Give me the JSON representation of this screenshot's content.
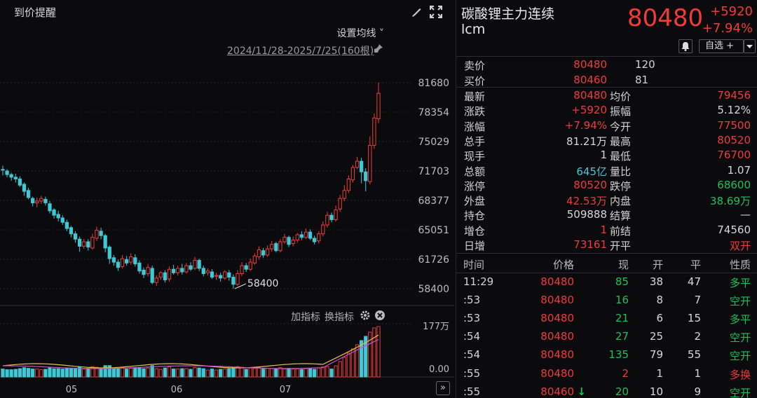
{
  "left": {
    "title": "到价提醒",
    "settings_label": "设置均线",
    "range_label": "2024/11/28-2025/7/25(160根)",
    "indicator_add": "加指标",
    "indicator_switch": "换指标",
    "nav_label": "»"
  },
  "chart_data": {
    "type": "candlestick",
    "y_ticks": [
      "81680",
      "78354",
      "75029",
      "71703",
      "68377",
      "65051",
      "61726",
      "58400"
    ],
    "x_ticks": [
      "05",
      "06",
      "07"
    ],
    "volume_ticks": [
      "177万",
      "0.00"
    ],
    "low_annotation": "58400",
    "ylim": [
      58400,
      81680
    ],
    "candles": [
      [
        71880,
        71800,
        72300,
        71200
      ],
      [
        71700,
        71300,
        71900,
        71000
      ],
      [
        71300,
        71000,
        71500,
        70600
      ],
      [
        71000,
        70800,
        71400,
        70400
      ],
      [
        70800,
        70100,
        71100,
        69900
      ],
      [
        70200,
        69400,
        70400,
        68900
      ],
      [
        69500,
        68700,
        69800,
        68500
      ],
      [
        68600,
        68100,
        68800,
        67700
      ],
      [
        68100,
        68300,
        68700,
        67600
      ],
      [
        68300,
        68600,
        68900,
        68000
      ],
      [
        68500,
        68100,
        68800,
        67800
      ],
      [
        68000,
        67200,
        68300,
        66900
      ],
      [
        67300,
        66700,
        67500,
        66300
      ],
      [
        66800,
        66400,
        67200,
        66000
      ],
      [
        66400,
        65900,
        66700,
        65600
      ],
      [
        65900,
        65200,
        66200,
        64900
      ],
      [
        65300,
        64600,
        65500,
        64200
      ],
      [
        64600,
        64000,
        64900,
        63600
      ],
      [
        64000,
        63200,
        64300,
        62600
      ],
      [
        63200,
        63700,
        64000,
        62900
      ],
      [
        63700,
        63100,
        64000,
        62700
      ],
      [
        63000,
        64200,
        64600,
        62800
      ],
      [
        64100,
        65000,
        65400,
        63800
      ],
      [
        64900,
        64400,
        65300,
        64000
      ],
      [
        64400,
        63000,
        64600,
        62500
      ],
      [
        63100,
        61800,
        63300,
        61200
      ],
      [
        61900,
        61400,
        62200,
        61000
      ],
      [
        61400,
        60800,
        61700,
        60400
      ],
      [
        60900,
        61800,
        62200,
        60700
      ],
      [
        61700,
        61300,
        62100,
        61000
      ],
      [
        61400,
        62000,
        62400,
        61100
      ],
      [
        61900,
        61200,
        62300,
        60900
      ],
      [
        61300,
        60400,
        61600,
        60100
      ],
      [
        60500,
        60000,
        60800,
        59600
      ],
      [
        60100,
        60800,
        61200,
        59800
      ],
      [
        60700,
        59100,
        61000,
        58900
      ],
      [
        59100,
        59600,
        59900,
        58700
      ],
      [
        59700,
        60200,
        60400,
        59400
      ],
      [
        60200,
        59400,
        60500,
        59100
      ],
      [
        59500,
        60600,
        60900,
        59200
      ],
      [
        60600,
        60200,
        61100,
        60000
      ],
      [
        60200,
        60700,
        61000,
        59900
      ],
      [
        60700,
        60300,
        61200,
        60000
      ],
      [
        60300,
        61000,
        61300,
        60100
      ],
      [
        61000,
        60600,
        61400,
        60400
      ],
      [
        60700,
        61600,
        62000,
        60500
      ],
      [
        61600,
        60700,
        61800,
        60400
      ],
      [
        60700,
        60100,
        61000,
        59800
      ],
      [
        60200,
        60400,
        60700,
        59900
      ],
      [
        60300,
        59700,
        60600,
        59500
      ],
      [
        59800,
        59900,
        60200,
        59400
      ],
      [
        59900,
        59600,
        60200,
        59200
      ],
      [
        59600,
        60300,
        60500,
        59400
      ],
      [
        60200,
        59700,
        60500,
        59300
      ],
      [
        59700,
        58900,
        60000,
        58400
      ],
      [
        58900,
        60100,
        60500,
        58700
      ],
      [
        60100,
        61000,
        61400,
        59800
      ],
      [
        61000,
        60600,
        61300,
        60300
      ],
      [
        60600,
        61400,
        61800,
        60400
      ],
      [
        61300,
        62100,
        62400,
        61100
      ],
      [
        62000,
        62800,
        63200,
        61700
      ],
      [
        62700,
        62200,
        63000,
        61900
      ],
      [
        62200,
        62900,
        63300,
        62000
      ],
      [
        62900,
        63400,
        63800,
        62600
      ],
      [
        63500,
        62700,
        63700,
        62500
      ],
      [
        62700,
        63700,
        64000,
        62500
      ],
      [
        63700,
        64200,
        64600,
        63500
      ],
      [
        64200,
        63400,
        64400,
        63100
      ],
      [
        63500,
        63900,
        64300,
        63200
      ],
      [
        63900,
        64500,
        64700,
        63600
      ],
      [
        64500,
        64200,
        64900,
        63900
      ],
      [
        64200,
        64800,
        65200,
        64000
      ],
      [
        64800,
        64100,
        65100,
        63900
      ],
      [
        64100,
        63700,
        64400,
        63400
      ],
      [
        63800,
        64600,
        64900,
        63500
      ],
      [
        64600,
        65600,
        66000,
        64300
      ],
      [
        65600,
        66700,
        67100,
        65300
      ],
      [
        66700,
        66200,
        67000,
        65900
      ],
      [
        66200,
        67300,
        67800,
        66000
      ],
      [
        67400,
        68600,
        69000,
        67100
      ],
      [
        68600,
        69500,
        70100,
        68300
      ],
      [
        69500,
        70800,
        71200,
        69200
      ],
      [
        70700,
        72100,
        72400,
        70400
      ],
      [
        72100,
        72800,
        73300,
        71900
      ],
      [
        72800,
        71600,
        73200,
        70300
      ],
      [
        71600,
        70600,
        72000,
        69400
      ],
      [
        70500,
        74600,
        75600,
        70200
      ],
      [
        74600,
        77700,
        78200,
        74200
      ],
      [
        77600,
        80480,
        81680,
        77100
      ]
    ]
  },
  "quote": {
    "name": "碳酸锂主力连续",
    "code": "lcm",
    "price": "80480",
    "change": "+5920",
    "change_pct": "+7.94%",
    "watch_label": "自选 +",
    "sell_label": "卖价",
    "sell_price": "80480",
    "sell_qty": "120",
    "buy_label": "买价",
    "buy_price": "80460",
    "buy_qty": "81",
    "stats": [
      {
        "l1": "最新",
        "v1": "80480",
        "c1": "red",
        "l2": "均价",
        "v2": "79456",
        "c2": "red"
      },
      {
        "l1": "涨跌",
        "v1": "+5920",
        "c1": "red",
        "l2": "振幅",
        "v2": "5.12%",
        "c2": "white"
      },
      {
        "l1": "涨幅",
        "v1": "+7.94%",
        "c1": "red",
        "l2": "今开",
        "v2": "77500",
        "c2": "red"
      },
      {
        "l1": "总手",
        "v1": "81.21万",
        "c1": "white",
        "l2": "最高",
        "v2": "80520",
        "c2": "red"
      },
      {
        "l1": "现手",
        "v1": "1",
        "c1": "white",
        "l2": "最低",
        "v2": "76700",
        "c2": "red"
      },
      {
        "l1": "总额",
        "v1": "645亿",
        "c1": "cyan",
        "l2": "量比",
        "v2": "1.07",
        "c2": "white"
      },
      {
        "l1": "涨停",
        "v1": "80520",
        "c1": "red",
        "l2": "跌停",
        "v2": "68600",
        "c2": "green"
      },
      {
        "l1": "外盘",
        "v1": "42.53万",
        "c1": "red",
        "l2": "内盘",
        "v2": "38.69万",
        "c2": "green"
      },
      {
        "l1": "持仓",
        "v1": "509888",
        "c1": "white",
        "l2": "结算",
        "v2": "—",
        "c2": "white"
      },
      {
        "l1": "增仓",
        "v1": "1",
        "c1": "red",
        "l2": "前结",
        "v2": "74560",
        "c2": "white"
      },
      {
        "l1": "日增",
        "v1": "73161",
        "c1": "red",
        "l2": "开平",
        "v2": "双开",
        "c2": "red"
      }
    ],
    "table_headers": [
      "时间",
      "价格",
      "现",
      "开",
      "平",
      "性质"
    ],
    "ticks": [
      {
        "time": "11:29",
        "price": "80480",
        "now": "85",
        "open": "38",
        "close": "47",
        "nature": "多平",
        "nc": "green",
        "nat": "green",
        "arrow": ""
      },
      {
        "time": ":53",
        "price": "80480",
        "now": "16",
        "open": "8",
        "close": "7",
        "nature": "空开",
        "nc": "green",
        "nat": "green",
        "arrow": ""
      },
      {
        "time": ":53",
        "price": "80480",
        "now": "21",
        "open": "6",
        "close": "15",
        "nature": "多平",
        "nc": "green",
        "nat": "green",
        "arrow": ""
      },
      {
        "time": ":54",
        "price": "80480",
        "now": "27",
        "open": "25",
        "close": "2",
        "nature": "空开",
        "nc": "green",
        "nat": "green",
        "arrow": ""
      },
      {
        "time": ":54",
        "price": "80480",
        "now": "135",
        "open": "79",
        "close": "55",
        "nature": "空开",
        "nc": "green",
        "nat": "green",
        "arrow": ""
      },
      {
        "time": ":55",
        "price": "80480",
        "now": "2",
        "open": "1",
        "close": "1",
        "nature": "多换",
        "nc": "red",
        "nat": "red",
        "arrow": ""
      },
      {
        "time": ":55",
        "price": "80460",
        "now": "20",
        "open": "10",
        "close": "9",
        "nature": "空开",
        "nc": "green",
        "nat": "green",
        "arrow": "↓"
      }
    ],
    "colors": {
      "up": "#f03b3b",
      "down": "#3fc8d6",
      "green": "#19c25c"
    }
  }
}
